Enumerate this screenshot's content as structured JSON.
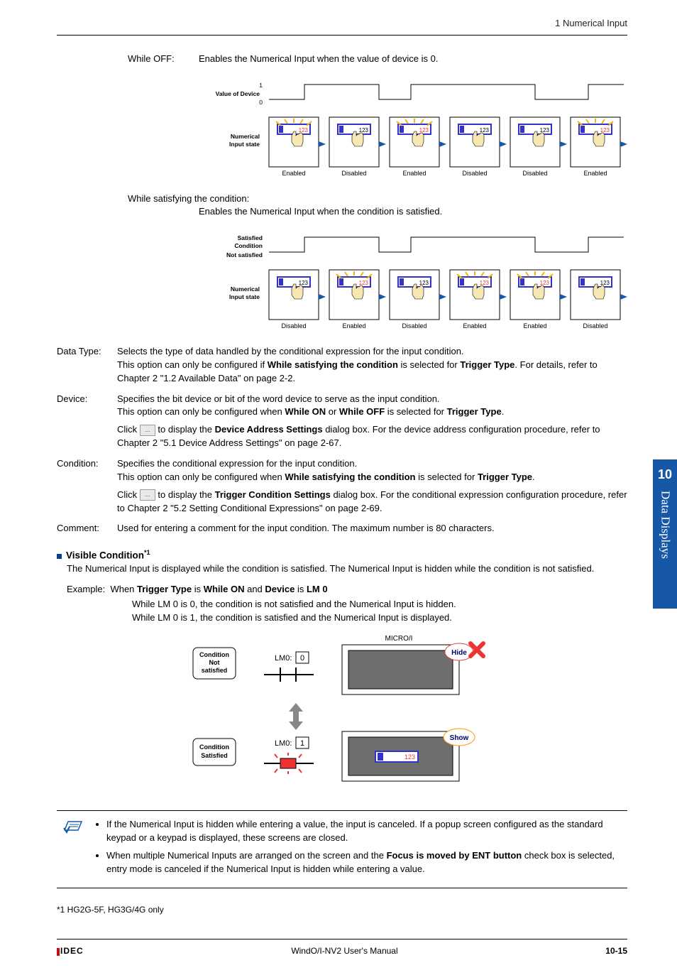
{
  "header": {
    "section": "1 Numerical Input"
  },
  "whileoff": {
    "label": "While OFF:",
    "desc": "Enables the Numerical Input when the value of device is 0."
  },
  "chart1": {
    "topLabel": "Value of Device",
    "botLabel": "Numerical Input state",
    "yhi": "1",
    "ylo": "0",
    "val": "123",
    "states": [
      "Enabled",
      "Disabled",
      "Enabled",
      "Disabled",
      "Disabled",
      "Enabled"
    ]
  },
  "whilecond": {
    "label": "While satisfying the condition:",
    "desc": "Enables the Numerical Input when the condition is satisfied."
  },
  "chart2": {
    "topLabel": "Condition",
    "hi": "Satisfied",
    "lo": "Not satisfied",
    "botLabel": "Numerical Input state",
    "val": "123",
    "states": [
      "Disabled",
      "Enabled",
      "Disabled",
      "Enabled",
      "Enabled",
      "Disabled"
    ]
  },
  "definitions": {
    "dataType": {
      "term": "Data Type:",
      "p1": "Selects the type of data handled by the conditional expression for the input condition.",
      "p2a": "This option can only be configured if ",
      "p2b": "While satisfying the condition",
      "p2c": " is selected for ",
      "p2d": "Trigger Type",
      "p2e": ". For details, refer to Chapter 2 \"1.2 Available Data\" on page 2-2."
    },
    "device": {
      "term": "Device:",
      "p1": "Specifies the bit device or bit of the word device to serve as the input condition.",
      "p2a": "This option can only be configured when ",
      "p2b": "While ON",
      "p2c": " or ",
      "p2d": "While OFF",
      "p2e": " is selected for ",
      "p2f": "Trigger Type",
      "p2g": ".",
      "p3a": "Click ",
      "p3b": " to display the ",
      "p3c": "Device Address Settings",
      "p3d": " dialog box. For the device address configuration procedure, refer to Chapter 2 \"5.1 Device Address Settings\" on page 2-67."
    },
    "condition": {
      "term": "Condition:",
      "p1": "Specifies the conditional expression for the input condition.",
      "p2a": "This option can only be configured when ",
      "p2b": "While satisfying the condition",
      "p2c": " is selected for ",
      "p2d": "Trigger Type",
      "p2e": ".",
      "p3a": "Click ",
      "p3b": " to display the ",
      "p3c": "Trigger Condition Settings",
      "p3d": " dialog box. For the conditional expression configuration procedure, refer to Chapter 2 \"5.2 Setting Conditional Expressions\" on page 2-69."
    },
    "comment": {
      "term": "Comment:",
      "p1": "Used for entering a comment for the input condition. The maximum number is 80 characters."
    }
  },
  "visible": {
    "titleA": "Visible Condition",
    "titleSup": "*1",
    "desc": "The Numerical Input is displayed while the condition is satisfied. The Numerical Input is hidden while the condition is not satisfied.",
    "ex_lead": "Example:",
    "ex_head_a": "When ",
    "ex_head_b": "Trigger Type",
    "ex_head_c": " is ",
    "ex_head_d": "While ON",
    "ex_head_e": " and ",
    "ex_head_f": "Device",
    "ex_head_g": " is ",
    "ex_head_h": "LM 0",
    "ex_l1": "While LM 0 is 0, the condition is not satisfied and the Numerical Input is hidden.",
    "ex_l2": "While LM 0 is 1, the condition is satisfied and the Numerical Input is displayed."
  },
  "diagram": {
    "microi": "MICRO/I",
    "cond_not_1": "Condition",
    "cond_not_2": "Not",
    "cond_not_3": "satisfied",
    "cond_yes_1": "Condition",
    "cond_yes_2": "Satisfied",
    "lm": "LM0:",
    "v0": "0",
    "v1": "1",
    "hide": "Hide",
    "show": "Show",
    "val": "123"
  },
  "note": {
    "li1a": "If the Numerical Input is hidden while entering a value, the input is canceled. If a popup screen configured as the standard keypad or a keypad is displayed, these screens are closed.",
    "li2a": "When multiple Numerical Inputs are arranged on the screen and the ",
    "li2b": "Focus is moved by ENT button",
    "li2c": " check box is selected, entry mode is canceled if the Numerical Input is hidden while entering a value."
  },
  "footnote": "*1  HG2G-5F, HG3G/4G only",
  "footer": {
    "logo": "IDEC",
    "center": "WindO/I-NV2 User's Manual",
    "page": "10-15"
  },
  "sideTab": {
    "num": "10",
    "text": "Data Displays"
  },
  "btnGlyph": "..."
}
